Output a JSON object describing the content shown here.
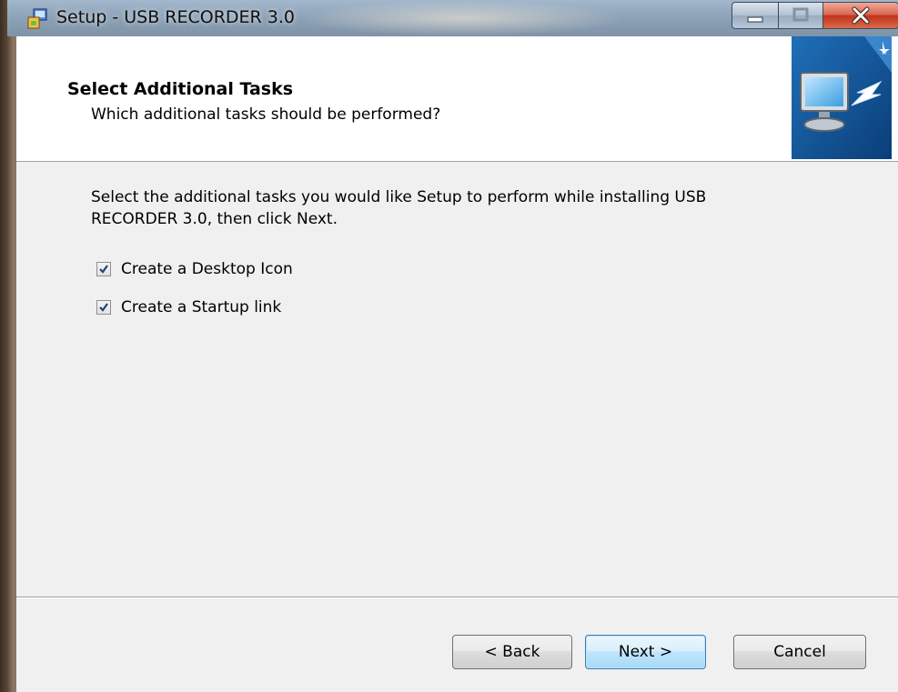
{
  "window": {
    "title": "Setup - USB RECORDER 3.0",
    "controls": [
      "minimize-icon",
      "maximize-icon",
      "close-icon"
    ]
  },
  "header": {
    "title": "Select Additional Tasks",
    "subtitle": "Which additional tasks should be performed?",
    "icon": "monitor-install-icon"
  },
  "main": {
    "description": "Select the additional tasks you would like Setup to perform while installing USB RECORDER 3.0, then click Next.",
    "tasks": [
      {
        "label": "Create a Desktop Icon",
        "checked": true
      },
      {
        "label": "Create a Startup link",
        "checked": true
      }
    ]
  },
  "footer": {
    "back_label": "< Back",
    "next_label": "Next >",
    "cancel_label": "Cancel"
  },
  "colors": {
    "dialog_bg": "#f0f0f0",
    "header_bg": "#ffffff",
    "default_button_border": "#3c7fb1",
    "close_button": "#c2331e"
  }
}
